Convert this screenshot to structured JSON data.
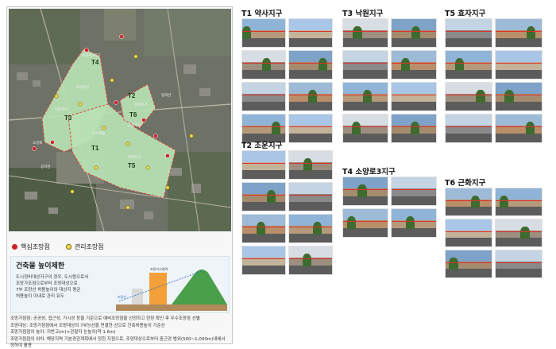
{
  "map": {
    "zone_labels": [
      "T1",
      "T2",
      "T3",
      "T4",
      "T5",
      "T6"
    ],
    "small_labels": [
      "약사지구",
      "조운지구",
      "낙원지구",
      "소양로3지구",
      "효자지구",
      "근화지구",
      "봉의산",
      "약사명동",
      "소양로",
      "공지천"
    ],
    "colors": {
      "zone_fill": "#b7e2b4",
      "zone_border": "#e03a3a",
      "map_base": "#6e7266"
    }
  },
  "legend": {
    "core_label": "핵심조망점",
    "manage_label": "관리조망점"
  },
  "height_limit": {
    "title": "건축물 높이제한",
    "lines": [
      "도시정비대상지구의 경우, 도시원으로서",
      "조망가조점으로부터 조망대상으로",
      "7부 조망선 허용높이의 대상지 평균",
      "허용높이 이내로 관리 유도"
    ],
    "diagram_label_building": "조망가시영역",
    "diagram_label_line": "조망선"
  },
  "notes": [
    "조망가점점: 공공성, 접근성, 가시성 등을 기준으로 예비조망점을 선정하고 현장 확인 후 우수조망점 선별",
    "조망대상: 조망가점점에서 조망대상의 7부능선을 연결한 선으로 건축허용높이 기준선",
    "조망가점점의 높이: 지반고(m)+관찰자 눈높이(약 1.6m)",
    "조망가점점의 위치: 해당지역 기본경관계획에서 정한 지점으로, 조망대상으로부터 중근경 범위(500~1,000m)내에서 정하여 활용"
  ],
  "districts": [
    {
      "title": "T1  약사지구",
      "rows": 4,
      "cols": 2
    },
    {
      "title": "T2  조운지구",
      "rows": 4,
      "cols": 2
    },
    {
      "title": "T3  낙원지구",
      "rows": 4,
      "cols": 2
    },
    {
      "title": "T4  소양로3지구",
      "rows": 2,
      "cols": 2
    },
    {
      "title": "T5  효자지구",
      "rows": 4,
      "cols": 2
    },
    {
      "title": "T6  근화지구",
      "rows": 3,
      "cols": 2
    }
  ]
}
